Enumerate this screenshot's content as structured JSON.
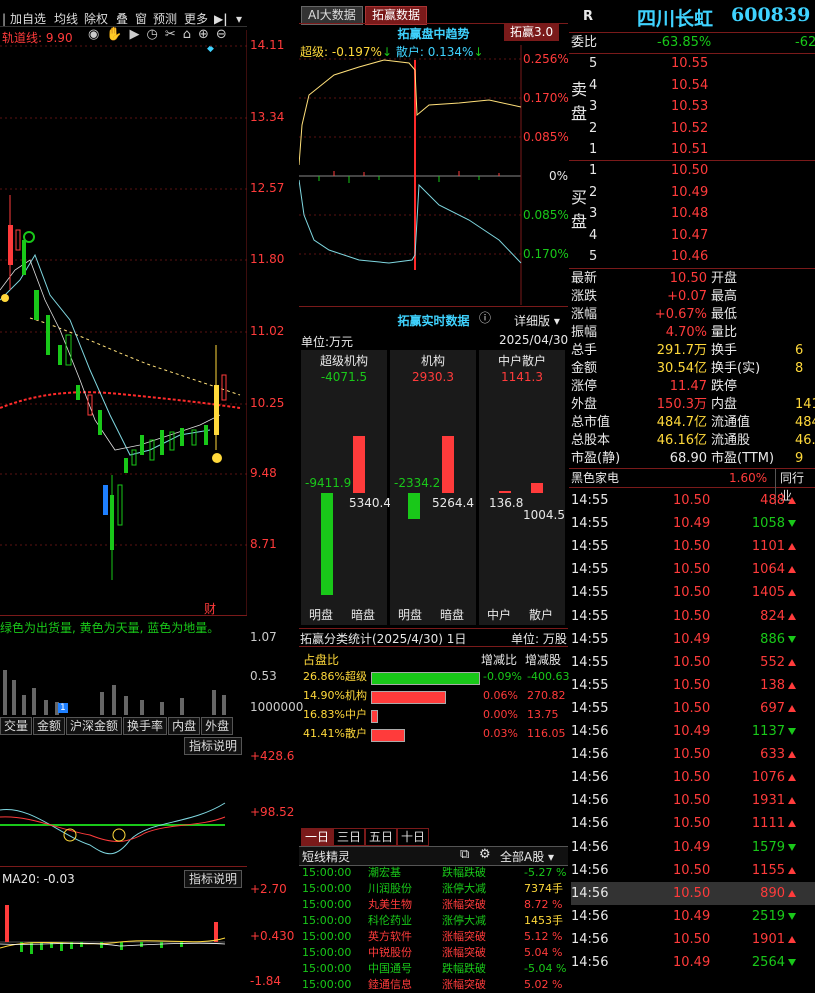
{
  "left": {
    "toolbar": [
      "加自选",
      "均线",
      "除权",
      "叠",
      "窗",
      "预测",
      "更多"
    ],
    "track_label": "轨道线: 9.90",
    "price_axis": [
      "14.11",
      "13.34",
      "12.57",
      "11.80",
      "11.02",
      "10.25",
      "9.48",
      "8.71"
    ],
    "cai_label": "财",
    "vol_legend": "绿色为出货量, 黄色为天量, 蓝色为地量。",
    "vol_axis": [
      "1.07",
      "0.53",
      "1000000"
    ],
    "vol_tag": "1",
    "indicator_tabs": [
      "交量",
      "金额",
      "沪深金额",
      "换手率",
      "内盘",
      "外盘"
    ],
    "indicator_btn": "指标说明",
    "ind1_axis": [
      "+428.6",
      "+98.52"
    ],
    "ma_label": "MA20: -0.03",
    "ind2_btn": "指标说明",
    "ind2_axis": [
      "+2.70",
      "+0.430",
      "-1.84"
    ]
  },
  "mid": {
    "tab_ai": "AI大数据",
    "tab_tuo": "拓赢数据",
    "trend_title": "拓赢盘中趋势",
    "version": "拓赢3.0",
    "super_label": "超级: -0.197%",
    "retail_label": "散户: 0.134%",
    "trend_axis": [
      "0.256%",
      "0.170%",
      "0.085%",
      "0%",
      "0.085%",
      "0.170%"
    ],
    "realtime_title": "拓赢实时数据",
    "detail_btn": "详细版",
    "unit": "单位:万元",
    "date": "2025/04/30",
    "groups": [
      {
        "name": "超级机构",
        "net": "-4071.5",
        "left_val": "-9411.9",
        "right_val": "5340.4",
        "l": "明盘",
        "r": "暗盘"
      },
      {
        "name": "机构",
        "net": "2930.3",
        "left_val": "-2334.2",
        "right_val": "5264.4",
        "l": "明盘",
        "r": "暗盘"
      },
      {
        "name": "中户散户",
        "net": "1141.3",
        "left_val": "136.8",
        "right_val": "1004.5",
        "l": "中户",
        "r": "散户"
      }
    ],
    "class_title": "拓赢分类统计(2025/4/30) 1日",
    "class_unit": "单位: 万股",
    "class_headers": [
      "占盘比",
      "增减比",
      "增减股"
    ],
    "classes": [
      {
        "pct": "26.86%",
        "name": "超级",
        "chg": "-0.09%",
        "shares": "-400.63",
        "fill": 0.99,
        "color": "#19c819"
      },
      {
        "pct": "14.90%",
        "name": "机构",
        "chg": "0.06%",
        "shares": "270.82",
        "fill": 0.68,
        "color": "#ff3b3b"
      },
      {
        "pct": "16.83%",
        "name": "中户",
        "chg": "0.00%",
        "shares": "13.75",
        "fill": 0.05,
        "color": "#ff3b3b"
      },
      {
        "pct": "41.41%",
        "name": "散户",
        "chg": "0.03%",
        "shares": "116.05",
        "fill": 0.3,
        "color": "#ff3b3b"
      }
    ],
    "period_tabs": [
      "一日",
      "三日",
      "五日",
      "十日"
    ],
    "sprite_title": "短线精灵",
    "sprite_filter": "全部A股",
    "sprites": [
      {
        "time": "15:00:00",
        "name": "潮宏基",
        "type": "跌幅跌破",
        "val": "-5.27 %",
        "vc": "green"
      },
      {
        "time": "15:00:00",
        "name": "川润股份",
        "type": "涨停大减",
        "val": "7374手",
        "vc": "yellow"
      },
      {
        "time": "15:00:00",
        "name": "丸美生物",
        "type": "涨幅突破",
        "val": "8.72 %",
        "vc": "red"
      },
      {
        "time": "15:00:00",
        "name": "科伦药业",
        "type": "涨停大减",
        "val": "1453手",
        "vc": "yellow"
      },
      {
        "time": "15:00:00",
        "name": "英方软件",
        "type": "涨幅突破",
        "val": "5.12 %",
        "vc": "red"
      },
      {
        "time": "15:00:00",
        "name": "中锐股份",
        "type": "涨幅突破",
        "val": "5.04 %",
        "vc": "red"
      },
      {
        "time": "15:00:00",
        "name": "中国通号",
        "type": "跌幅跌破",
        "val": "-5.04 %",
        "vc": "green"
      },
      {
        "time": "15:00:00",
        "name": "錴通信息",
        "type": "涨幅突破",
        "val": "5.02 %",
        "vc": "red"
      }
    ]
  },
  "right": {
    "r_badge": "R",
    "stock_name": "四川长虹",
    "stock_code": "600839",
    "weibi_label": "委比",
    "weibi_val": "-63.85%",
    "weibi_cut": "-62",
    "sell_label": "卖盘",
    "buy_label": "买盘",
    "sells": [
      {
        "n": "5",
        "p": "10.55"
      },
      {
        "n": "4",
        "p": "10.54"
      },
      {
        "n": "3",
        "p": "10.53"
      },
      {
        "n": "2",
        "p": "10.52"
      },
      {
        "n": "1",
        "p": "10.51"
      }
    ],
    "buys": [
      {
        "n": "1",
        "p": "10.50"
      },
      {
        "n": "2",
        "p": "10.49"
      },
      {
        "n": "3",
        "p": "10.48"
      },
      {
        "n": "4",
        "p": "10.47"
      },
      {
        "n": "5",
        "p": "10.46"
      }
    ],
    "quotes": [
      {
        "l": "最新",
        "v": "10.50",
        "vc": "red",
        "l2": "开盘"
      },
      {
        "l": "涨跌",
        "v": "+0.07",
        "vc": "red",
        "l2": "最高"
      },
      {
        "l": "涨幅",
        "v": "+0.67%",
        "vc": "red",
        "l2": "最低"
      },
      {
        "l": "振幅",
        "v": "4.70%",
        "vc": "red",
        "l2": "量比"
      },
      {
        "l": "总手",
        "v": "291.7万",
        "vc": "yellow",
        "l2": "换手",
        "v2": "6"
      },
      {
        "l": "金额",
        "v": "30.54亿",
        "vc": "yellow",
        "l2": "换手(实)",
        "v2": "8"
      },
      {
        "l": "涨停",
        "v": "11.47",
        "vc": "red",
        "l2": "跌停"
      },
      {
        "l": "外盘",
        "v": "150.3万",
        "vc": "red",
        "l2": "内盘",
        "v2": "141"
      },
      {
        "l": "总市值",
        "v": "484.7亿",
        "vc": "yellow",
        "l2": "流通值",
        "v2": "484"
      },
      {
        "l": "总股本",
        "v": "46.16亿",
        "vc": "yellow",
        "l2": "流通股",
        "v2": "46."
      },
      {
        "l": "市盈(静)",
        "v": "68.90",
        "vc": "white",
        "l2": "市盈(TTM)",
        "v2": "9"
      }
    ],
    "sector_name": "黑色家电",
    "sector_pct": "1.60%",
    "sector_peer": "同行业",
    "ticks": [
      {
        "t": "14:55",
        "p": "10.50",
        "pc": "red",
        "v": "488",
        "d": "up"
      },
      {
        "t": "14:55",
        "p": "10.49",
        "pc": "red",
        "v": "1058",
        "d": "dn"
      },
      {
        "t": "14:55",
        "p": "10.50",
        "pc": "red",
        "v": "1101",
        "d": "up"
      },
      {
        "t": "14:55",
        "p": "10.50",
        "pc": "red",
        "v": "1064",
        "d": "up"
      },
      {
        "t": "14:55",
        "p": "10.50",
        "pc": "red",
        "v": "1405",
        "d": "up"
      },
      {
        "t": "14:55",
        "p": "10.50",
        "pc": "red",
        "v": "824",
        "d": "up"
      },
      {
        "t": "14:55",
        "p": "10.49",
        "pc": "red",
        "v": "886",
        "d": "dn"
      },
      {
        "t": "14:55",
        "p": "10.50",
        "pc": "red",
        "v": "552",
        "d": "up"
      },
      {
        "t": "14:55",
        "p": "10.50",
        "pc": "red",
        "v": "138",
        "d": "up"
      },
      {
        "t": "14:55",
        "p": "10.50",
        "pc": "red",
        "v": "697",
        "d": "up"
      },
      {
        "t": "14:56",
        "p": "10.49",
        "pc": "red",
        "v": "1137",
        "d": "dn"
      },
      {
        "t": "14:56",
        "p": "10.50",
        "pc": "red",
        "v": "633",
        "d": "up"
      },
      {
        "t": "14:56",
        "p": "10.50",
        "pc": "red",
        "v": "1076",
        "d": "up"
      },
      {
        "t": "14:56",
        "p": "10.50",
        "pc": "red",
        "v": "1931",
        "d": "up"
      },
      {
        "t": "14:56",
        "p": "10.50",
        "pc": "red",
        "v": "1111",
        "d": "up"
      },
      {
        "t": "14:56",
        "p": "10.49",
        "pc": "red",
        "v": "1579",
        "d": "dn"
      },
      {
        "t": "14:56",
        "p": "10.50",
        "pc": "red",
        "v": "1155",
        "d": "up"
      },
      {
        "t": "14:56",
        "p": "10.50",
        "pc": "red",
        "v": "890",
        "d": "up"
      },
      {
        "t": "14:56",
        "p": "10.49",
        "pc": "red",
        "v": "2519",
        "d": "dn"
      },
      {
        "t": "14:56",
        "p": "10.50",
        "pc": "red",
        "v": "1901",
        "d": "up"
      },
      {
        "t": "14:56",
        "p": "10.49",
        "pc": "red",
        "v": "2564",
        "d": "dn"
      }
    ]
  }
}
